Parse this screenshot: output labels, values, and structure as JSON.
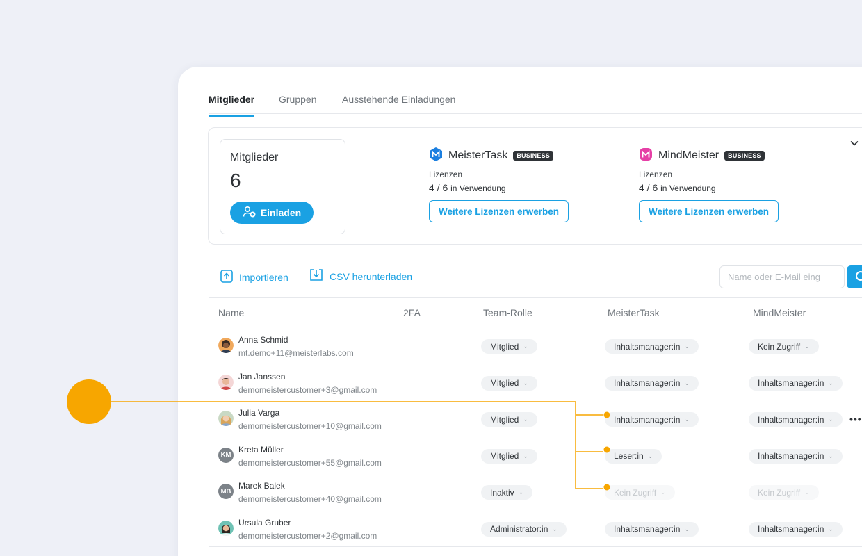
{
  "tabs": [
    {
      "label": "Mitglieder",
      "active": true
    },
    {
      "label": "Gruppen",
      "active": false
    },
    {
      "label": "Ausstehende Einladungen",
      "active": false
    }
  ],
  "members_card": {
    "label": "Mitglieder",
    "count": "6",
    "invite_label": "Einladen"
  },
  "products": [
    {
      "name": "MeisterTask",
      "badge": "BUSINESS",
      "licenses_label": "Lizenzen",
      "usage": "4 / 6",
      "usage_suffix": "in Verwendung",
      "buy_label": "Weitere Lizenzen erwerben",
      "color": "#1b7fe0"
    },
    {
      "name": "MindMeister",
      "badge": "BUSINESS",
      "licenses_label": "Lizenzen",
      "usage": "4 / 6",
      "usage_suffix": "in Verwendung",
      "buy_label": "Weitere Lizenzen erwerben",
      "color": "#e63fa6"
    }
  ],
  "toolbar": {
    "import_label": "Importieren",
    "csv_label": "CSV herunterladen",
    "search_placeholder": "Name oder E-Mail eing"
  },
  "table": {
    "headers": {
      "name": "Name",
      "twofa": "2FA",
      "role": "Team-Rolle",
      "meistertask": "MeisterTask",
      "mindmeister": "MindMeister"
    },
    "rows": [
      {
        "name": "Anna Schmid",
        "email": "mt.demo+11@meisterlabs.com",
        "role": "Mitglied",
        "mt": "Inhaltsmanager:in",
        "mm": "Kein Zugriff"
      },
      {
        "name": "Jan Janssen",
        "email": "demomeistercustomer+3@gmail.com",
        "role": "Mitglied",
        "mt": "Inhaltsmanager:in",
        "mm": "Inhaltsmanager:in"
      },
      {
        "name": "Julia Varga",
        "email": "demomeistercustomer+10@gmail.com",
        "role": "Mitglied",
        "mt": "Inhaltsmanager:in",
        "mm": "Inhaltsmanager:in"
      },
      {
        "name": "Kreta Müller",
        "initials": "KM",
        "email": "demomeistercustomer+55@gmail.com",
        "role": "Mitglied",
        "mt": "Leser:in",
        "mm": "Inhaltsmanager:in"
      },
      {
        "name": "Marek Balek",
        "initials": "MB",
        "email": "demomeistercustomer+40@gmail.com",
        "role": "Inaktiv",
        "mt": "Kein Zugriff",
        "mm": "Kein Zugriff"
      },
      {
        "name": "Ursula Gruber",
        "email": "demomeistercustomer+2@gmail.com",
        "role": "Administrator:in",
        "mt": "Inhaltsmanager:in",
        "mm": "Inhaltsmanager:in"
      }
    ]
  },
  "colors": {
    "accent": "#1aa1e3",
    "callout": "#f7a600"
  },
  "icons": [
    "chevron-down-icon",
    "add-user-icon",
    "import-icon",
    "download-icon",
    "search-icon",
    "more-icon"
  ]
}
